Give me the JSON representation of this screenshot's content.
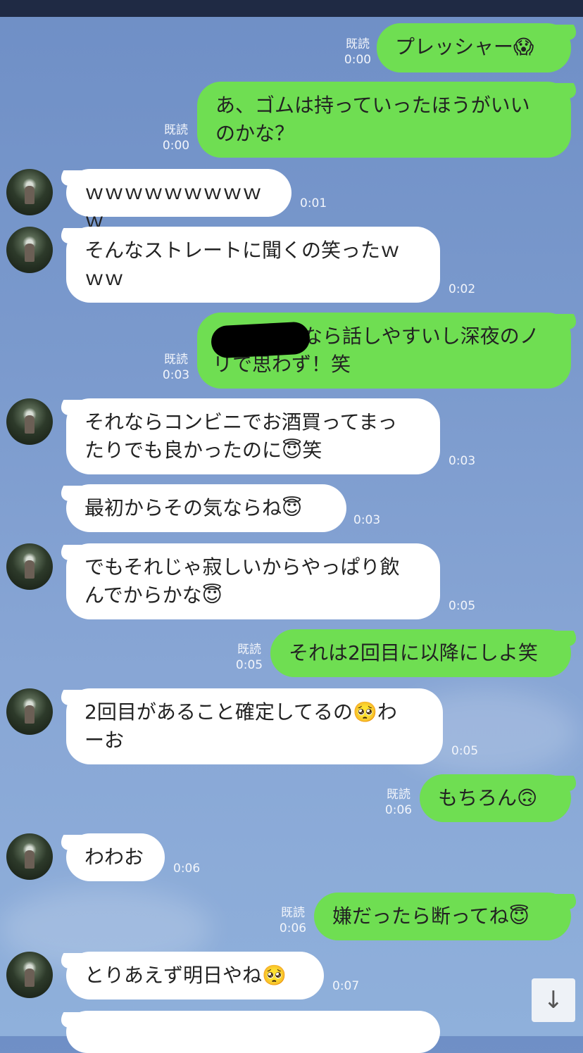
{
  "messages": [
    {
      "side": "out",
      "text": "プレッシャー😱",
      "read": "既読",
      "time": "0:00"
    },
    {
      "side": "out",
      "text": "あ、ゴムは持っていったほうがいいのかな？",
      "read": "既読",
      "time": "0:00"
    },
    {
      "side": "in",
      "text": "ｗｗｗｗｗｗｗｗｗｗ",
      "time": "0:01"
    },
    {
      "side": "in",
      "text": "そんなストレートに聞くの笑ったｗｗｗ",
      "time": "0:02"
    },
    {
      "side": "out",
      "text": "なら話しやすいし深夜のノリで思わず！笑",
      "read": "既読",
      "time": "0:03"
    },
    {
      "side": "in",
      "text": "それならコンビニでお酒買ってまったりでも良かったのに😇笑",
      "time": "0:03"
    },
    {
      "side": "in",
      "text": "最初からその気ならね😇",
      "time": "0:03"
    },
    {
      "side": "in",
      "text": "でもそれじゃ寂しいからやっぱり飲んでからかな😇",
      "time": "0:05"
    },
    {
      "side": "out",
      "text": "それは2回目に以降にしよ笑",
      "read": "既読",
      "time": "0:05"
    },
    {
      "side": "in",
      "text": "2回目があること確定してるの🥺わーお",
      "time": "0:05"
    },
    {
      "side": "out",
      "text": "もちろん🙃",
      "read": "既読",
      "time": "0:06"
    },
    {
      "side": "in",
      "text": "わわお",
      "time": "0:06"
    },
    {
      "side": "out",
      "text": "嫌だったら断ってね😇",
      "read": "既読",
      "time": "0:06"
    },
    {
      "side": "in",
      "text": "とりあえず明日やね🥺",
      "time": "0:07"
    }
  ],
  "display": {
    "m0": "プレッシャー😱",
    "m1a": "あ、ゴムは持っていったほうがいい",
    "m1b": "のかな？",
    "m2": "ｗｗｗｗｗｗｗｗｗｗ",
    "m3a": "そんなストレートに聞くの笑ったｗ",
    "m3b": "ｗｗ",
    "m4a": "なら話しやすいし深夜のノ",
    "m4b": "リで思わず！笑",
    "m5a": "それならコンビニでお酒買ってまっ",
    "m5b": "たりでも良かったのに😇笑",
    "m6": "最初からその気ならね😇",
    "m7a": "でもそれじゃ寂しいからやっぱり飲",
    "m7b": "んでからかな😇",
    "m8": "それは2回目に以降にしよ笑",
    "m9a": "2回目があること確定してるの🥺わ",
    "m9b": "ーお",
    "m10": "もちろん🙃",
    "m11": "わわお",
    "m12": "嫌だったら断ってね😇",
    "m13": "とりあえず明日やね🥺",
    "read": "既読",
    "t0": "0:00",
    "t1": "0:00",
    "t2": "0:01",
    "t3": "0:02",
    "t4": "0:03",
    "t5": "0:03",
    "t6": "0:03",
    "t7": "0:05",
    "t8": "0:05",
    "t9": "0:05",
    "t10": "0:06",
    "t11": "0:06",
    "t12": "0:06",
    "t13": "0:07"
  },
  "scroll_button": {
    "icon": "arrow-down-icon",
    "glyph": "↓"
  }
}
